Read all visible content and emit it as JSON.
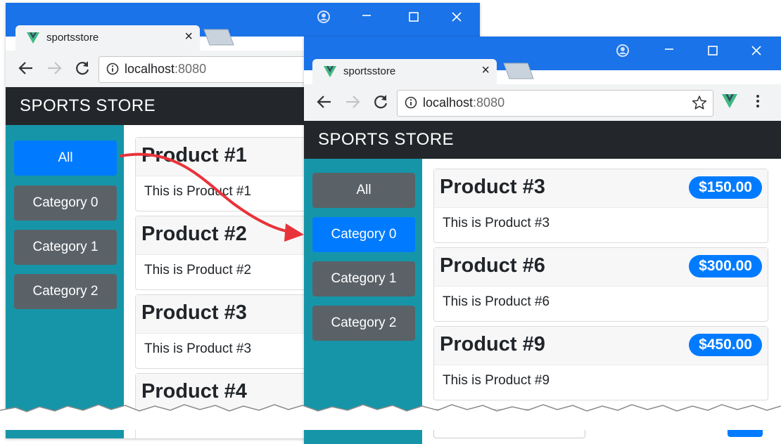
{
  "back_window": {
    "tab_title": "sportsstore",
    "tab_close": "×",
    "url_host": "localhost",
    "url_port": ":8080",
    "brand": "SPORTS STORE",
    "categories": [
      {
        "label": "All",
        "active": true
      },
      {
        "label": "Category 0",
        "active": false
      },
      {
        "label": "Category 1",
        "active": false
      },
      {
        "label": "Category 2",
        "active": false
      }
    ],
    "products": [
      {
        "name": "Product #1",
        "description": "This is Product #1"
      },
      {
        "name": "Product #2",
        "description": "This is Product #2"
      },
      {
        "name": "Product #3",
        "description": "This is Product #3"
      },
      {
        "name": "Product #4",
        "description": ""
      }
    ]
  },
  "front_window": {
    "tab_title": "sportsstore",
    "tab_close": "×",
    "url_host": "localhost",
    "url_port": ":8080",
    "brand": "SPORTS STORE",
    "categories": [
      {
        "label": "All",
        "active": false
      },
      {
        "label": "Category 0",
        "active": true
      },
      {
        "label": "Category 1",
        "active": false
      },
      {
        "label": "Category 2",
        "active": false
      }
    ],
    "products": [
      {
        "name": "Product #3",
        "price": "$150.00",
        "description": "This is Product #3"
      },
      {
        "name": "Product #6",
        "price": "$300.00",
        "description": "This is Product #6"
      },
      {
        "name": "Product #9",
        "price": "$450.00",
        "description": "This is Product #9"
      }
    ]
  },
  "colors": {
    "chrome_titlebar": "#1a73e8",
    "navbar": "#23272b",
    "sidebar": "#1695a8",
    "button_active": "#007bff",
    "button_inactive": "#5a6268",
    "annotation_arrow": "#e8333a"
  },
  "icons": [
    "vue-logo-icon",
    "close-icon",
    "back-arrow-icon",
    "forward-arrow-icon",
    "reload-icon",
    "info-icon",
    "star-icon",
    "menu-dots-icon",
    "profile-icon",
    "minimize-icon",
    "maximize-icon"
  ]
}
